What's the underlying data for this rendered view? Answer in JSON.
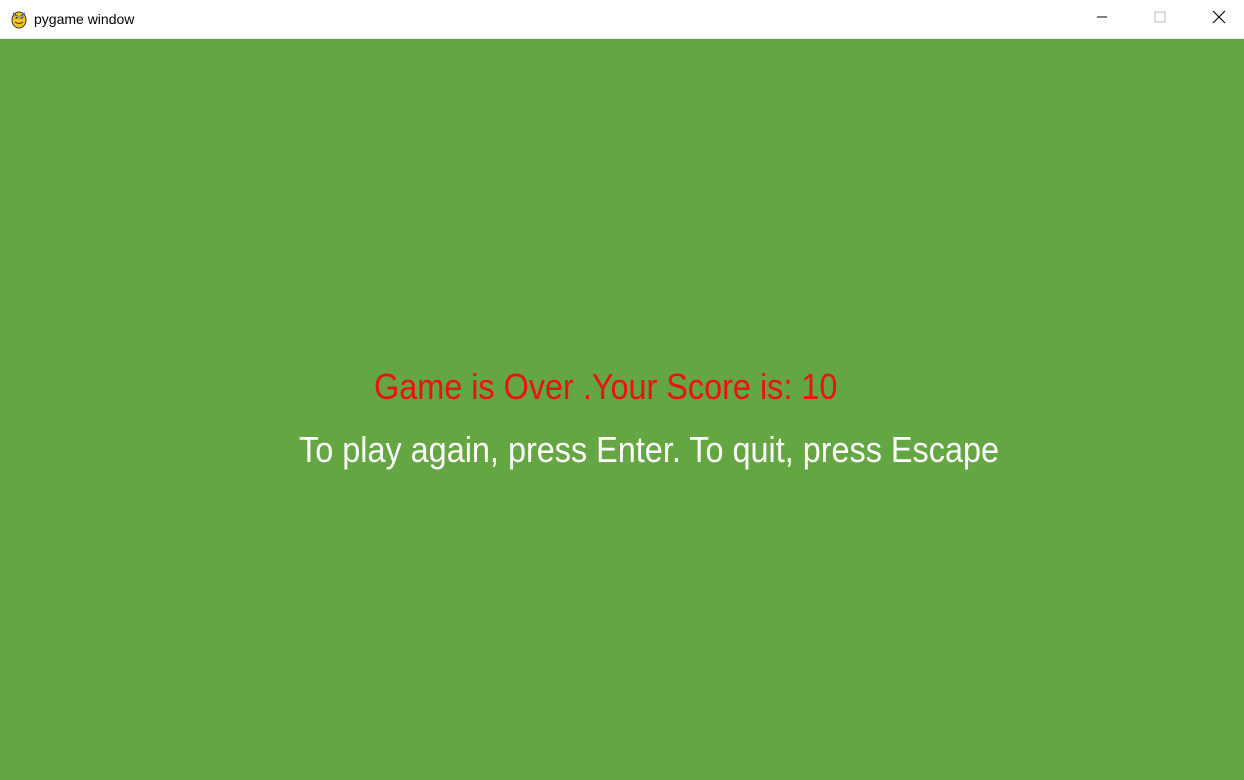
{
  "window": {
    "title": "pygame window",
    "icon": "pygame-snake-icon",
    "controls": {
      "minimize_icon": "minimize-icon",
      "maximize_icon": "maximize-icon",
      "close_icon": "close-icon"
    }
  },
  "game": {
    "background_color": "#64a641",
    "game_over_text": "Game is Over .Your Score is: 10",
    "game_over_color": "#ee1111",
    "instruction_text": "To play again, press Enter. To quit, press Escape",
    "instruction_color": "#ffffff"
  }
}
